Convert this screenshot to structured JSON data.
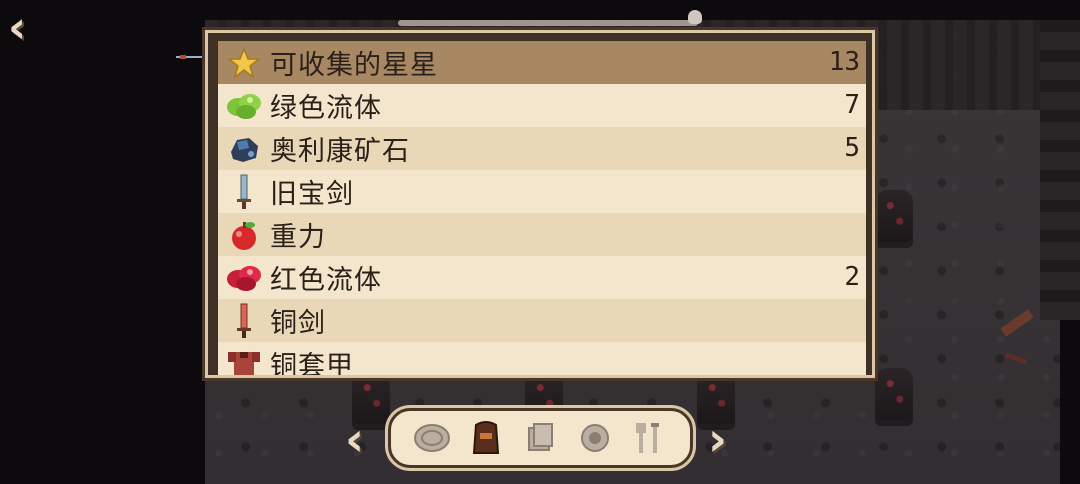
{
  "nav": {
    "back_icon": "back-arrow-icon"
  },
  "inventory": {
    "items": [
      {
        "name": "可收集的星星",
        "count": "13",
        "icon": "star-icon",
        "selected": true
      },
      {
        "name": "绿色流体",
        "count": "7",
        "icon": "green-fluid-icon"
      },
      {
        "name": "奥利康矿石",
        "count": "5",
        "icon": "ore-icon"
      },
      {
        "name": "旧宝剑",
        "count": "",
        "icon": "old-sword-icon"
      },
      {
        "name": "重力",
        "count": "",
        "icon": "apple-icon"
      },
      {
        "name": "红色流体",
        "count": "2",
        "icon": "red-fluid-icon"
      },
      {
        "name": "铜剑",
        "count": "",
        "icon": "copper-sword-icon"
      },
      {
        "name": "铜套甲",
        "count": "",
        "icon": "copper-armor-icon"
      }
    ]
  },
  "categories": {
    "tabs": [
      {
        "icon": "rune-circle-icon",
        "active": false
      },
      {
        "icon": "armor-icon",
        "active": true
      },
      {
        "icon": "scroll-icon",
        "active": false
      },
      {
        "icon": "gear-orb-icon",
        "active": false
      },
      {
        "icon": "tools-icon",
        "active": false
      }
    ],
    "prev_icon": "chevron-left-icon",
    "next_icon": "chevron-right-icon"
  },
  "colors": {
    "panel_border": "#d9c7a6",
    "row_light": "#f3e6cc",
    "row_alt": "#e8d8b8",
    "row_selected": "#a78862",
    "text": "#2b201a"
  }
}
